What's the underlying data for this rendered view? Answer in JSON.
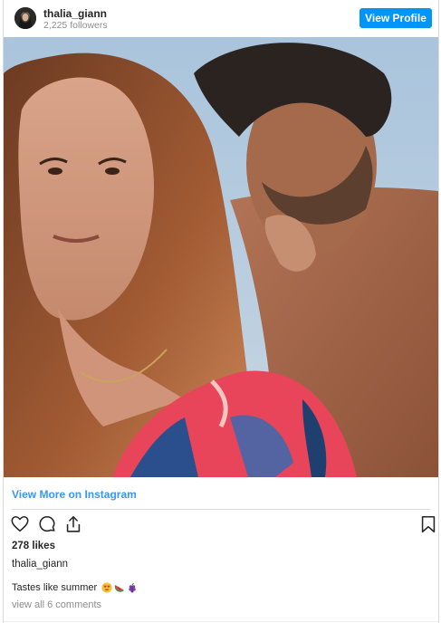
{
  "header": {
    "username": "thalia_giann",
    "followers": "2,225 followers",
    "view_profile_label": "View Profile"
  },
  "post": {
    "view_more_label": "View More on Instagram",
    "likes": "278 likes",
    "owner": "thalia_giann",
    "caption": "Tastes like summer",
    "caption_emojis": [
      "smiling-face-with-heart-eyes-emoji",
      "watermelon-emoji",
      "grapes-emoji"
    ],
    "comments_link": "view all 6 comments"
  },
  "icons": {
    "like": "heart-icon",
    "comment": "comment-bubble-icon",
    "share": "share-upload-icon",
    "save": "bookmark-icon"
  },
  "colors": {
    "accent": "#0095f6",
    "link": "#3897f0",
    "muted": "#8e8e8e",
    "text": "#262626",
    "border": "#dbdbdb"
  }
}
